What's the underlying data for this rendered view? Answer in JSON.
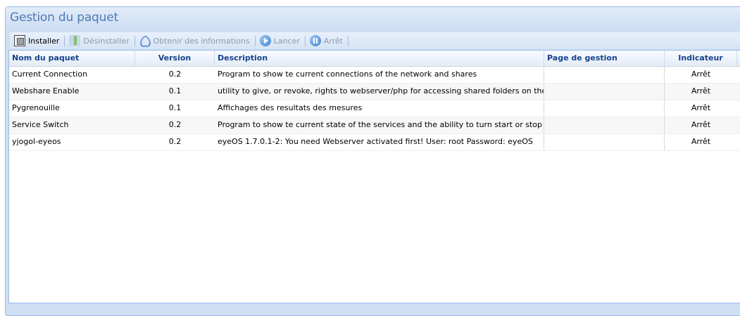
{
  "window": {
    "title": "Gestion du paquet"
  },
  "toolbar": {
    "buttons": [
      {
        "label": "Installer",
        "icon": "install-icon",
        "enabled": true
      },
      {
        "label": "Désinstaller",
        "icon": "uninstall-icon",
        "enabled": false
      },
      {
        "label": "Obtenir des informations",
        "icon": "info-icon",
        "enabled": false
      },
      {
        "label": "Lancer",
        "icon": "play-icon",
        "enabled": false
      },
      {
        "label": "Arrêt",
        "icon": "stop-icon",
        "enabled": false
      }
    ]
  },
  "table": {
    "columns": [
      "Nom du paquet",
      "Version",
      "Description",
      "Page de gestion",
      "Indicateur"
    ],
    "rows": [
      [
        "Current Connection",
        "0.2",
        "Program to show te current connections of the network and shares",
        "",
        "Arrêt"
      ],
      [
        "Webshare Enable",
        "0.1",
        "utility to give, or revoke, rights to webserver/php for accessing shared folders on the",
        "",
        "Arrêt"
      ],
      [
        "Pygrenouille",
        "0.1",
        "Affichages des resultats des mesures",
        "",
        "Arrêt"
      ],
      [
        "Service Switch",
        "0.2",
        "Program to show te current state of the services and the ability to turn start or stop e",
        "",
        "Arrêt"
      ],
      [
        "yjogol-eyeos",
        "0.2",
        "eyeOS 1.7.0.1-2: You need Webserver activated first! User: root Password: eyeOS",
        "",
        "Arrêt"
      ]
    ]
  },
  "colors": {
    "accent": "#15428b",
    "title": "#4f79b3",
    "panel": "#cfdff3",
    "border": "#99bbe8"
  }
}
